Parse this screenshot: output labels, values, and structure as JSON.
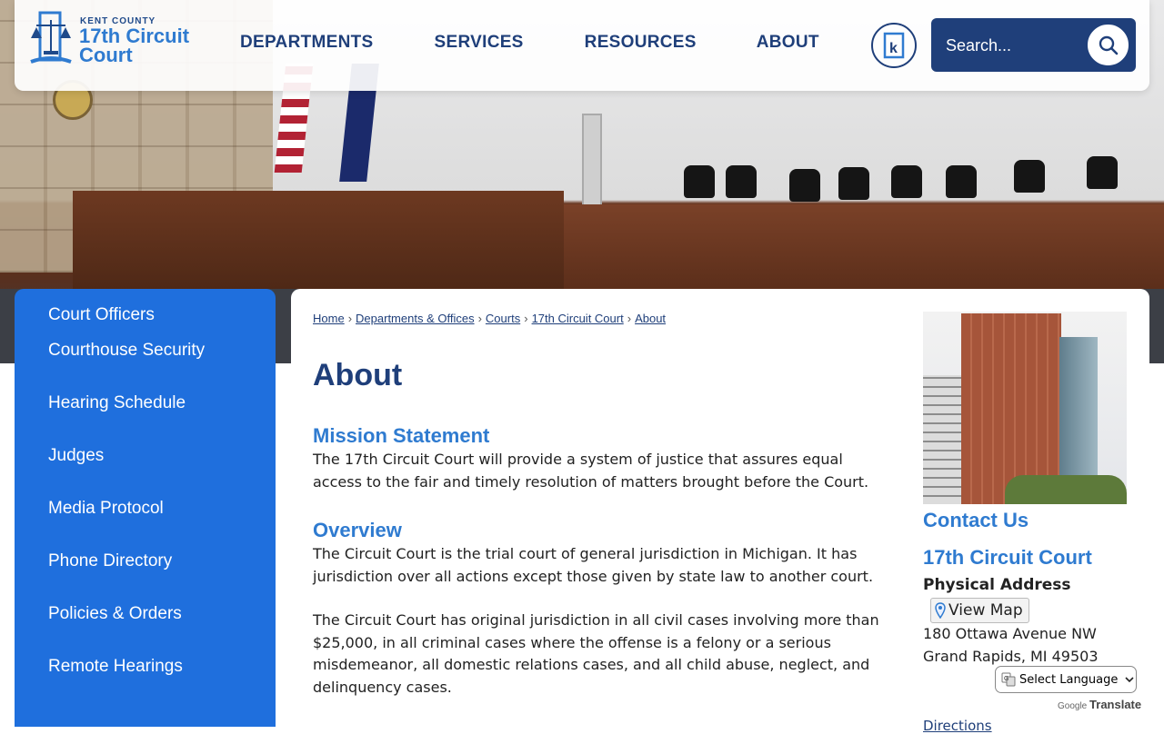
{
  "header": {
    "logo": {
      "county": "KENT COUNTY",
      "line1": "17th Circuit",
      "line2": "Court"
    },
    "nav": [
      "DEPARTMENTS",
      "SERVICES",
      "RESOURCES",
      "ABOUT"
    ],
    "search_placeholder": "Search..."
  },
  "sidebar": {
    "items": [
      "Court Officers",
      "Courthouse Security",
      "Hearing Schedule",
      "Judges",
      "Media Protocol",
      "Phone Directory",
      "Policies & Orders",
      "Remote Hearings"
    ]
  },
  "breadcrumb": [
    "Home",
    "Departments & Offices",
    "Courts",
    "17th Circuit Court",
    "About"
  ],
  "main": {
    "title": "About",
    "mission_heading": "Mission Statement",
    "mission_text": "The 17th Circuit Court will provide a system of justice that assures equal access to the fair and timely resolution of matters brought before the Court.",
    "overview_heading": "Overview",
    "overview_p1": "The Circuit Court is the trial court of general jurisdiction in Michigan. It has jurisdiction over all actions except those given by state law to another court.",
    "overview_p2": "The Circuit Court has original jurisdiction in all civil cases involving more than $25,000, in all criminal cases where the offense is a felony or a serious misdemeanor, all domestic relations cases, and all child abuse, neglect, and delinquency cases."
  },
  "contact": {
    "heading": "Contact Us",
    "court_name": "17th Circuit Court",
    "physical_label": "Physical Address",
    "view_map": "View Map",
    "address_line1": "180 Ottawa Avenue NW",
    "address_line2": "Grand Rapids, MI 49503",
    "directions": "Directions"
  },
  "translate": {
    "select_label": "Select Language",
    "powered_google": "Google",
    "powered_translate": "Translate"
  },
  "colors": {
    "navy": "#1f3f7a",
    "blue": "#2f7bd0",
    "sidebar": "#1f6fdd"
  }
}
